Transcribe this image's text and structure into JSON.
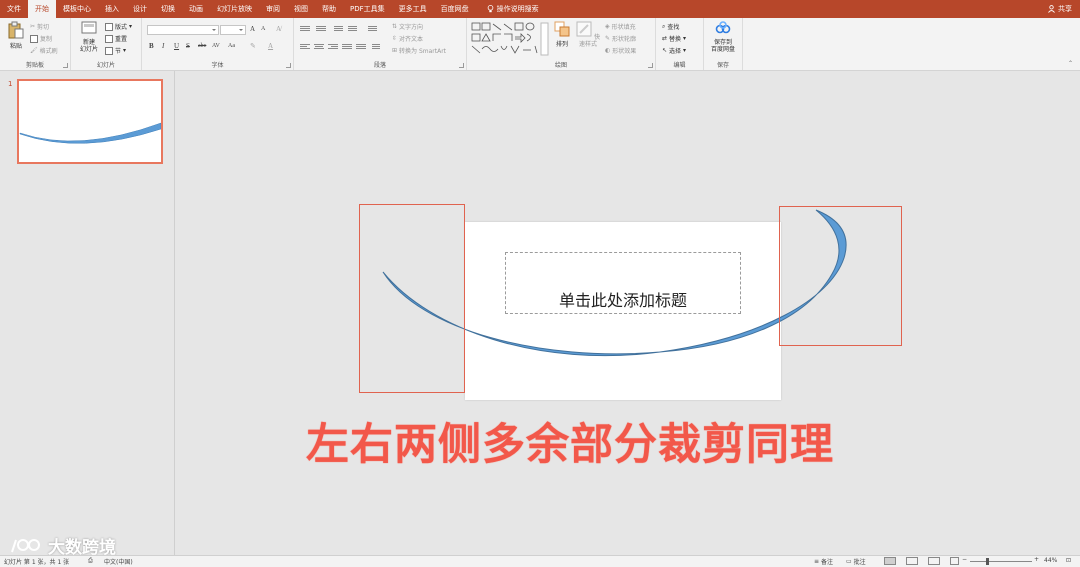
{
  "ribbon_tabs": [
    "文件",
    "开始",
    "模板中心",
    "插入",
    "设计",
    "切换",
    "动画",
    "幻灯片放映",
    "审阅",
    "视图",
    "帮助",
    "PDF工具集",
    "更多工具",
    "百度网盘"
  ],
  "active_tab": "开始",
  "search_label": "操作说明搜索",
  "share_label": "共享",
  "clipboard": {
    "paste": "粘贴",
    "cut": "剪切",
    "copy": "复制",
    "format_painter": "格式刷",
    "label": "剪贴板"
  },
  "slides_group": {
    "new_slide_line1": "新建",
    "new_slide_line2": "幻灯片",
    "layout": "版式",
    "reset": "重置",
    "section": "节",
    "label": "幻灯片"
  },
  "font_group": {
    "bold": "B",
    "italic": "I",
    "underline": "U",
    "strike": "S",
    "shadow": "abc",
    "spacing": "AV",
    "case": "Aa",
    "grow": "A",
    "shrink": "A",
    "label": "字体"
  },
  "paragraph_group": {
    "text_direction": "文字方向",
    "align_text": "对齐文本",
    "smartart": "转换为 SmartArt",
    "label": "段落"
  },
  "drawing_group": {
    "arrange": "排列",
    "quick_styles": "快速样式",
    "shape_fill": "形状填充",
    "shape_outline": "形状轮廓",
    "shape_effects": "形状效果",
    "label": "绘图"
  },
  "editing_group": {
    "find": "查找",
    "replace": "替换",
    "select": "选择",
    "label": "编辑"
  },
  "save_group": {
    "save_line1": "保存到",
    "save_line2": "百度网盘",
    "label": "保存"
  },
  "thumbnail": {
    "number": "1"
  },
  "slide": {
    "title_placeholder": "单击此处添加标题"
  },
  "caption": "左右两侧多余部分裁剪同理",
  "watermark": "大数跨境",
  "status": {
    "slide_info": "幻灯片 第 1 张，共 1 张",
    "language": "中文(中国)",
    "notes": "备注",
    "comments": "批注",
    "zoom": "44%"
  },
  "colors": {
    "accent": "#b7472a",
    "crop_box": "#e0634f",
    "arc": "#5b9bd5",
    "caption": "#f2584a"
  }
}
